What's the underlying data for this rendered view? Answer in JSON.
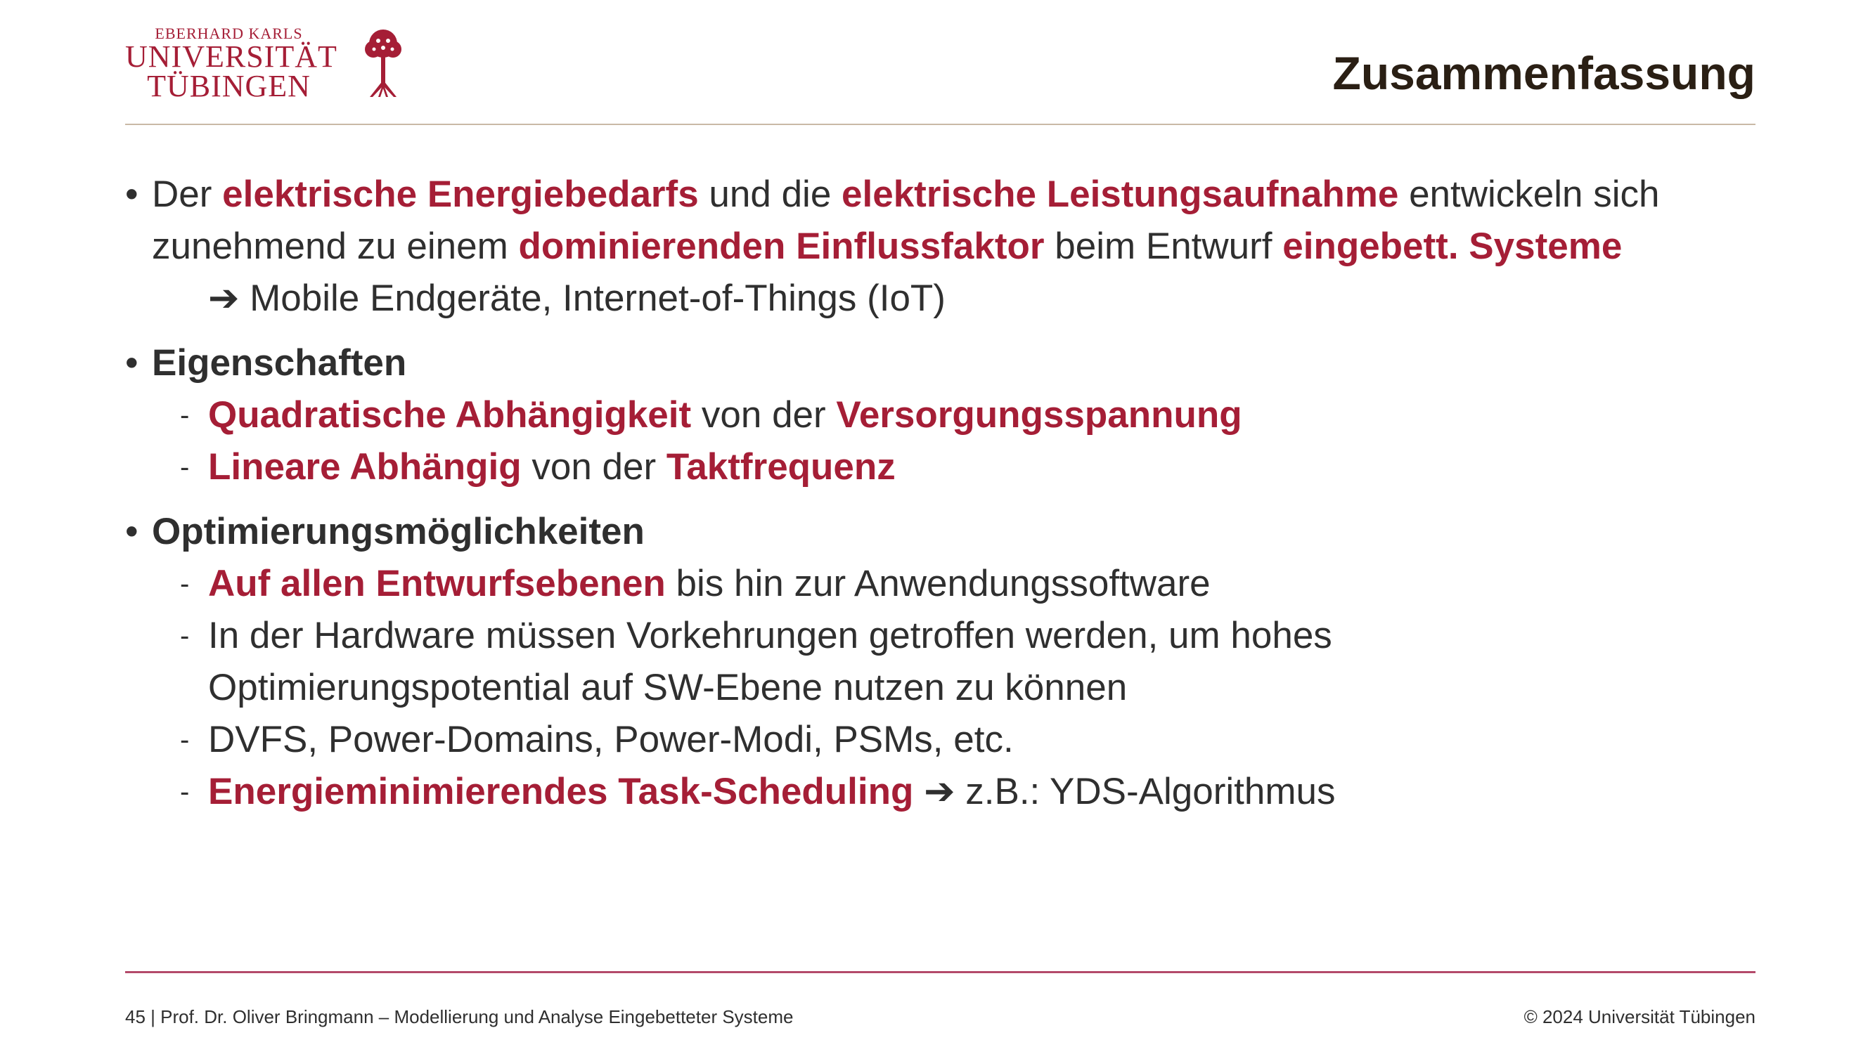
{
  "logo": {
    "line1": "EBERHARD KARLS",
    "line2": "UNIVERSITÄT",
    "line3": "TÜBINGEN",
    "icon": "tree-icon",
    "color": "#a51e36"
  },
  "title": "Zusammenfassung",
  "bullets": {
    "b1": {
      "t1": "Der ",
      "h1": "elektrische Energiebedarfs",
      "t2": " und die ",
      "h2": "elektrische Leistungsaufnahme",
      "t3": " entwickeln sich zunehmend zu einem ",
      "h3": "dominierenden Einflussfaktor",
      "t4": " beim Entwurf ",
      "h4": "eingebett. Systeme",
      "arrow": "➔",
      "arrow_text": " Mobile Endgeräte, Internet-of-Things (IoT)"
    },
    "b2": {
      "heading": "Eigenschaften",
      "s1": {
        "h1": "Quadratische Abhängigkeit",
        "t1": " von der ",
        "h2": "Versorgungsspannung"
      },
      "s2": {
        "h1": "Lineare Abhängig",
        "t1": " von der ",
        "h2": "Taktfrequenz"
      }
    },
    "b3": {
      "heading": "Optimierungsmöglichkeiten",
      "s1": {
        "h1": "Auf allen Entwurfsebenen",
        "t1": " bis hin zur Anwendungssoftware"
      },
      "s2": {
        "t1": "In der Hardware müssen Vorkehrungen getroffen werden, um hohes Optimierungspotential auf SW-Ebene nutzen zu können"
      },
      "s3": {
        "t1": "DVFS, Power-Domains, Power-Modi, PSMs, etc."
      },
      "s4": {
        "h1": "Energieminimierendes Task-Scheduling",
        "arrow": "➔",
        "t1": " z.B.: YDS-Algorithmus"
      }
    },
    "bullet_char": "•",
    "dash_char": "-"
  },
  "footer": {
    "left": "45 | Prof. Dr. Oliver Bringmann – Modellierung und Analyse Eingebetteter Systeme",
    "right": "© 2024 Universität Tübingen"
  },
  "colors": {
    "accent": "#a51e36",
    "text": "#2f2f2f",
    "title": "#2a1f14"
  }
}
